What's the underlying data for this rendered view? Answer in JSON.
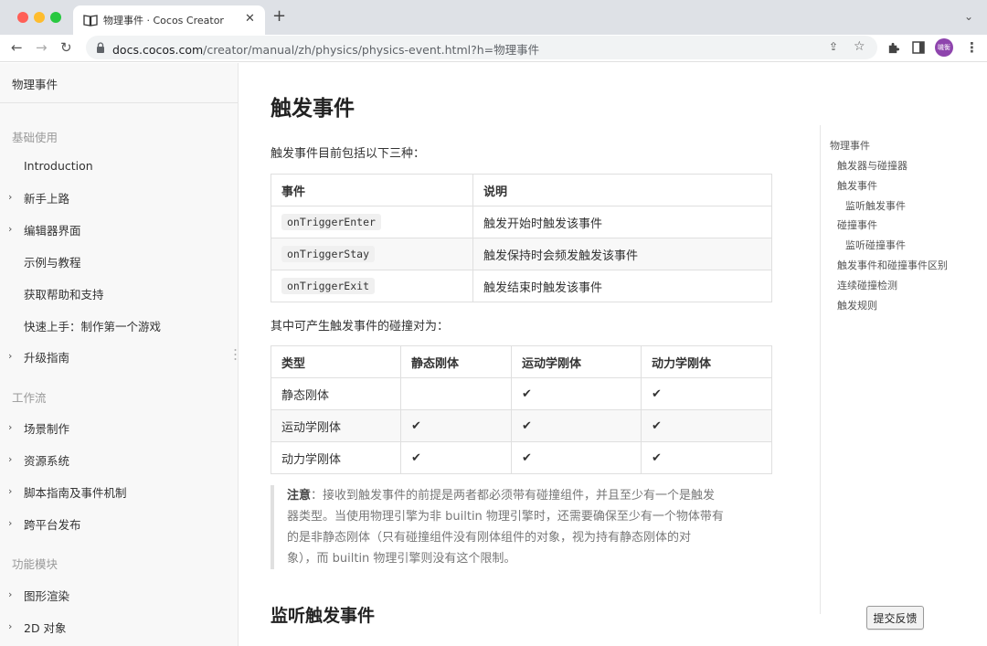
{
  "browser": {
    "tab_title": "物理事件 · Cocos Creator",
    "url_host": "docs.cocos.com",
    "url_path": "/creator/manual/zh/physics/physics-event.html?h=物理事件",
    "avatar_text": "嘰衡",
    "avatar_color": "#8e44ad"
  },
  "sidebar": {
    "title": "物理事件",
    "groups": [
      {
        "label": "基础使用",
        "items": [
          {
            "label": "Introduction",
            "expandable": false
          },
          {
            "label": "新手上路",
            "expandable": true
          },
          {
            "label": "编辑器界面",
            "expandable": true
          },
          {
            "label": "示例与教程",
            "expandable": false
          },
          {
            "label": "获取帮助和支持",
            "expandable": false
          },
          {
            "label": "快速上手：制作第一个游戏",
            "expandable": false
          },
          {
            "label": "升级指南",
            "expandable": true
          }
        ]
      },
      {
        "label": "工作流",
        "items": [
          {
            "label": "场景制作",
            "expandable": true
          },
          {
            "label": "资源系统",
            "expandable": true
          },
          {
            "label": "脚本指南及事件机制",
            "expandable": true
          },
          {
            "label": "跨平台发布",
            "expandable": true
          }
        ]
      },
      {
        "label": "功能模块",
        "items": [
          {
            "label": "图形渲染",
            "expandable": true
          },
          {
            "label": "2D 对象",
            "expandable": true
          }
        ]
      }
    ]
  },
  "content": {
    "title": "触发事件",
    "intro": "触发事件目前包括以下三种：",
    "events_table": {
      "headers": [
        "事件",
        "说明"
      ],
      "rows": [
        [
          "onTriggerEnter",
          "触发开始时触发该事件"
        ],
        [
          "onTriggerStay",
          "触发保持时会频发触发该事件"
        ],
        [
          "onTriggerExit",
          "触发结束时触发该事件"
        ]
      ]
    },
    "pairs_intro": "其中可产生触发事件的碰撞对为：",
    "pairs_table": {
      "headers": [
        "类型",
        "静态刚体",
        "运动学刚体",
        "动力学刚体"
      ],
      "rows": [
        [
          "静态刚体",
          "",
          "✔",
          "✔"
        ],
        [
          "运动学刚体",
          "✔",
          "✔",
          "✔"
        ],
        [
          "动力学刚体",
          "✔",
          "✔",
          "✔"
        ]
      ]
    },
    "note": {
      "label": "注意",
      "lines": [
        "：接收到触发事件的前提是两者都必须带有碰撞组件，并且至少有一个是触发",
        "器类型。当使用物理引擎为非 builtin 物理引擎时，还需要确保至少有一个物体带有",
        "的是非静态刚体（只有碰撞组件没有刚体组件的对象，视为持有静态刚体的对",
        "象），而 builtin 物理引擎则没有这个限制。"
      ]
    },
    "subtitle": "监听触发事件"
  },
  "toc": {
    "items": [
      {
        "label": "物理事件",
        "level": 0
      },
      {
        "label": "触发器与碰撞器",
        "level": 1
      },
      {
        "label": "触发事件",
        "level": 1
      },
      {
        "label": "监听触发事件",
        "level": 2
      },
      {
        "label": "碰撞事件",
        "level": 1
      },
      {
        "label": "监听碰撞事件",
        "level": 2
      },
      {
        "label": "触发事件和碰撞事件区别",
        "level": 1
      },
      {
        "label": "连续碰撞检测",
        "level": 1
      },
      {
        "label": "触发规则",
        "level": 1
      }
    ]
  },
  "feedback_label": "提交反馈"
}
